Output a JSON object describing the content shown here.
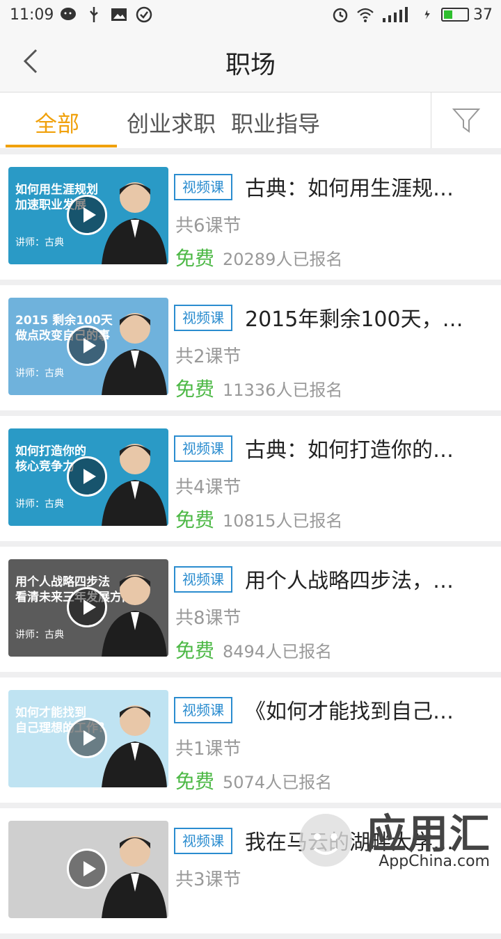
{
  "status_bar": {
    "time": "11:09",
    "battery": "37"
  },
  "nav": {
    "title": "职场"
  },
  "tabs": [
    {
      "label": "全部",
      "active": true
    },
    {
      "label": "创业求职",
      "active": false
    },
    {
      "label": "职业指导",
      "active": false
    }
  ],
  "courses": [
    {
      "thumb_line1": "如何用生涯规划",
      "thumb_line2": "加速职业发展",
      "thumb_line3": "讲师：古典",
      "thumb_bg": "#2a9ac6",
      "badge": "视频课",
      "title": "古典：如何用生涯规…",
      "lessons": "共6课节",
      "price": "免费",
      "enrolled": "20289人已报名"
    },
    {
      "thumb_line1": "2015 剩余100天",
      "thumb_line2": "做点改变自己的事",
      "thumb_line3": "讲师：古典",
      "thumb_bg": "#6fb2dc",
      "badge": "视频课",
      "title": "2015年剩余100天，…",
      "lessons": "共2课节",
      "price": "免费",
      "enrolled": "11336人已报名"
    },
    {
      "thumb_line1": "如何打造你的",
      "thumb_line2": "核心竞争力",
      "thumb_line3": "讲师：古典",
      "thumb_bg": "#2a9ac6",
      "badge": "视频课",
      "title": "古典：如何打造你的…",
      "lessons": "共4课节",
      "price": "免费",
      "enrolled": "10815人已报名"
    },
    {
      "thumb_line1": "用个人战略四步法",
      "thumb_line2": "看清未来三年发展方向",
      "thumb_line3": "讲师：古典",
      "thumb_bg": "#5b5b5b",
      "badge": "视频课",
      "title": "用个人战略四步法，…",
      "lessons": "共8课节",
      "price": "免费",
      "enrolled": "8494人已报名"
    },
    {
      "thumb_line1": "如何才能找到",
      "thumb_line2": "自己理想的工作？",
      "thumb_line3": "",
      "thumb_bg": "#bfe3f2",
      "badge": "视频课",
      "title": "《如何才能找到自己…",
      "lessons": "共1课节",
      "price": "免费",
      "enrolled": "5074人已报名"
    },
    {
      "thumb_line1": "",
      "thumb_line2": "",
      "thumb_line3": "",
      "thumb_bg": "#cfcfcf",
      "badge": "视频课",
      "title": "我在马云的湖畔大学…",
      "lessons": "共3课节",
      "price": "",
      "enrolled": ""
    }
  ],
  "watermark": {
    "brand": "应用汇",
    "sub": "AppChina.com"
  },
  "colors": {
    "accent": "#f0a10c",
    "badge_blue": "#2a8ccf",
    "free_green": "#4cb845"
  }
}
